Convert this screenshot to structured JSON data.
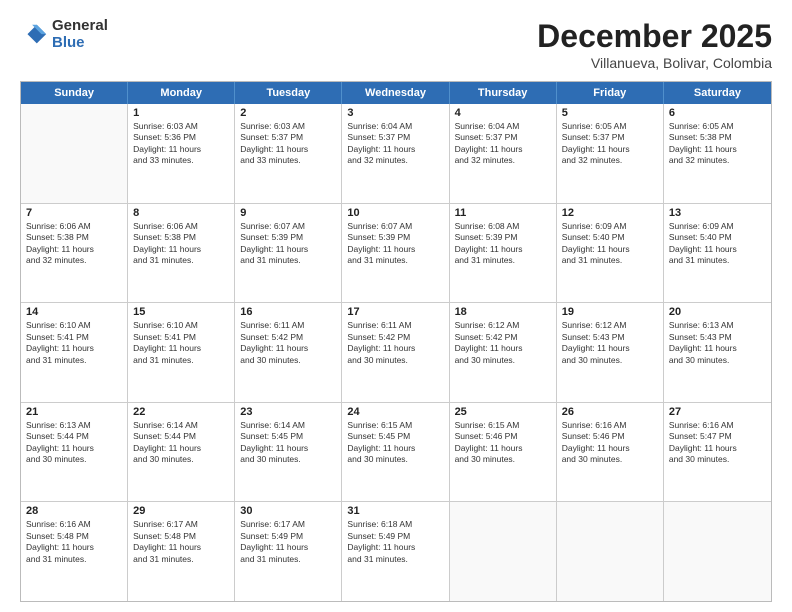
{
  "logo": {
    "general": "General",
    "blue": "Blue"
  },
  "title": "December 2025",
  "subtitle": "Villanueva, Bolivar, Colombia",
  "header_days": [
    "Sunday",
    "Monday",
    "Tuesday",
    "Wednesday",
    "Thursday",
    "Friday",
    "Saturday"
  ],
  "weeks": [
    [
      {
        "day": "",
        "info": ""
      },
      {
        "day": "1",
        "info": "Sunrise: 6:03 AM\nSunset: 5:36 PM\nDaylight: 11 hours\nand 33 minutes."
      },
      {
        "day": "2",
        "info": "Sunrise: 6:03 AM\nSunset: 5:37 PM\nDaylight: 11 hours\nand 33 minutes."
      },
      {
        "day": "3",
        "info": "Sunrise: 6:04 AM\nSunset: 5:37 PM\nDaylight: 11 hours\nand 32 minutes."
      },
      {
        "day": "4",
        "info": "Sunrise: 6:04 AM\nSunset: 5:37 PM\nDaylight: 11 hours\nand 32 minutes."
      },
      {
        "day": "5",
        "info": "Sunrise: 6:05 AM\nSunset: 5:37 PM\nDaylight: 11 hours\nand 32 minutes."
      },
      {
        "day": "6",
        "info": "Sunrise: 6:05 AM\nSunset: 5:38 PM\nDaylight: 11 hours\nand 32 minutes."
      }
    ],
    [
      {
        "day": "7",
        "info": "Sunrise: 6:06 AM\nSunset: 5:38 PM\nDaylight: 11 hours\nand 32 minutes."
      },
      {
        "day": "8",
        "info": "Sunrise: 6:06 AM\nSunset: 5:38 PM\nDaylight: 11 hours\nand 31 minutes."
      },
      {
        "day": "9",
        "info": "Sunrise: 6:07 AM\nSunset: 5:39 PM\nDaylight: 11 hours\nand 31 minutes."
      },
      {
        "day": "10",
        "info": "Sunrise: 6:07 AM\nSunset: 5:39 PM\nDaylight: 11 hours\nand 31 minutes."
      },
      {
        "day": "11",
        "info": "Sunrise: 6:08 AM\nSunset: 5:39 PM\nDaylight: 11 hours\nand 31 minutes."
      },
      {
        "day": "12",
        "info": "Sunrise: 6:09 AM\nSunset: 5:40 PM\nDaylight: 11 hours\nand 31 minutes."
      },
      {
        "day": "13",
        "info": "Sunrise: 6:09 AM\nSunset: 5:40 PM\nDaylight: 11 hours\nand 31 minutes."
      }
    ],
    [
      {
        "day": "14",
        "info": "Sunrise: 6:10 AM\nSunset: 5:41 PM\nDaylight: 11 hours\nand 31 minutes."
      },
      {
        "day": "15",
        "info": "Sunrise: 6:10 AM\nSunset: 5:41 PM\nDaylight: 11 hours\nand 31 minutes."
      },
      {
        "day": "16",
        "info": "Sunrise: 6:11 AM\nSunset: 5:42 PM\nDaylight: 11 hours\nand 30 minutes."
      },
      {
        "day": "17",
        "info": "Sunrise: 6:11 AM\nSunset: 5:42 PM\nDaylight: 11 hours\nand 30 minutes."
      },
      {
        "day": "18",
        "info": "Sunrise: 6:12 AM\nSunset: 5:42 PM\nDaylight: 11 hours\nand 30 minutes."
      },
      {
        "day": "19",
        "info": "Sunrise: 6:12 AM\nSunset: 5:43 PM\nDaylight: 11 hours\nand 30 minutes."
      },
      {
        "day": "20",
        "info": "Sunrise: 6:13 AM\nSunset: 5:43 PM\nDaylight: 11 hours\nand 30 minutes."
      }
    ],
    [
      {
        "day": "21",
        "info": "Sunrise: 6:13 AM\nSunset: 5:44 PM\nDaylight: 11 hours\nand 30 minutes."
      },
      {
        "day": "22",
        "info": "Sunrise: 6:14 AM\nSunset: 5:44 PM\nDaylight: 11 hours\nand 30 minutes."
      },
      {
        "day": "23",
        "info": "Sunrise: 6:14 AM\nSunset: 5:45 PM\nDaylight: 11 hours\nand 30 minutes."
      },
      {
        "day": "24",
        "info": "Sunrise: 6:15 AM\nSunset: 5:45 PM\nDaylight: 11 hours\nand 30 minutes."
      },
      {
        "day": "25",
        "info": "Sunrise: 6:15 AM\nSunset: 5:46 PM\nDaylight: 11 hours\nand 30 minutes."
      },
      {
        "day": "26",
        "info": "Sunrise: 6:16 AM\nSunset: 5:46 PM\nDaylight: 11 hours\nand 30 minutes."
      },
      {
        "day": "27",
        "info": "Sunrise: 6:16 AM\nSunset: 5:47 PM\nDaylight: 11 hours\nand 30 minutes."
      }
    ],
    [
      {
        "day": "28",
        "info": "Sunrise: 6:16 AM\nSunset: 5:48 PM\nDaylight: 11 hours\nand 31 minutes."
      },
      {
        "day": "29",
        "info": "Sunrise: 6:17 AM\nSunset: 5:48 PM\nDaylight: 11 hours\nand 31 minutes."
      },
      {
        "day": "30",
        "info": "Sunrise: 6:17 AM\nSunset: 5:49 PM\nDaylight: 11 hours\nand 31 minutes."
      },
      {
        "day": "31",
        "info": "Sunrise: 6:18 AM\nSunset: 5:49 PM\nDaylight: 11 hours\nand 31 minutes."
      },
      {
        "day": "",
        "info": ""
      },
      {
        "day": "",
        "info": ""
      },
      {
        "day": "",
        "info": ""
      }
    ]
  ]
}
